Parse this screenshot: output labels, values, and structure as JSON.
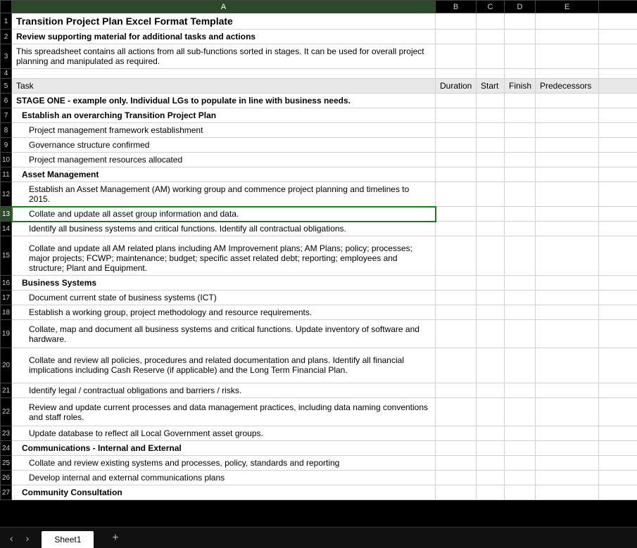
{
  "columns": [
    "A",
    "B",
    "C",
    "D",
    "E"
  ],
  "active_cell": {
    "row": 13,
    "col": "A"
  },
  "rows": [
    {
      "n": 1,
      "type": "title",
      "a": "Transition Project Plan Excel Format Template"
    },
    {
      "n": 2,
      "type": "bold",
      "a": "Review supporting material for additional tasks and actions"
    },
    {
      "n": 3,
      "type": "plain",
      "a": "This spreadsheet contains all actions from all sub-functions sorted in stages. It can be used for overall project planning and manipulated as required."
    },
    {
      "n": 4,
      "type": "empty",
      "a": ""
    },
    {
      "n": 5,
      "type": "header",
      "a": "Task",
      "b": "Duration",
      "c": "Start",
      "d": "Finish",
      "e": "Predecessors"
    },
    {
      "n": 6,
      "type": "bold",
      "a": "STAGE ONE - example only. Individual LGs to populate in line with business needs."
    },
    {
      "n": 7,
      "type": "bold1",
      "a": "Establish an overarching Transition Project Plan"
    },
    {
      "n": 8,
      "type": "p2",
      "a": "Project management framework establishment"
    },
    {
      "n": 9,
      "type": "p2",
      "a": "Governance structure confirmed"
    },
    {
      "n": 10,
      "type": "p2",
      "a": "Project management resources allocated"
    },
    {
      "n": 11,
      "type": "bold1",
      "a": "Asset Management"
    },
    {
      "n": 12,
      "type": "p2",
      "a": "Establish an Asset Management (AM) working group and commence project planning and timelines to 2015."
    },
    {
      "n": 13,
      "type": "p2sel",
      "a": "Collate and update all asset group information and data."
    },
    {
      "n": 14,
      "type": "p2",
      "a": "Identify all business systems and critical functions. Identify all contractual obligations."
    },
    {
      "n": 15,
      "type": "p2tall",
      "a": "Collate and update all AM related plans including AM Improvement plans; AM Plans; policy; processes; major projects; FCWP; maintenance; budget; specific asset related debt; reporting; employees and structure; Plant and Equipment."
    },
    {
      "n": 16,
      "type": "bold1",
      "a": "Business Systems"
    },
    {
      "n": 17,
      "type": "p2",
      "a": "Document current state of business systems (ICT)"
    },
    {
      "n": 18,
      "type": "p2",
      "a": "Establish a working group, project methodology and resource requirements."
    },
    {
      "n": 19,
      "type": "p2t2",
      "a": "Collate, map and document all business systems and critical functions. Update inventory of software and hardware."
    },
    {
      "n": 20,
      "type": "p2tall",
      "a": "Collate and review all policies, procedures and related documentation and plans.  Identify all financial implications including Cash Reserve (if applicable) and the Long Term Financial Plan."
    },
    {
      "n": 21,
      "type": "p2",
      "a": "Identify legal / contractual obligations and barriers / risks."
    },
    {
      "n": 22,
      "type": "p2t2",
      "a": "Review and update current processes and data management practices, including data naming conventions and staff roles."
    },
    {
      "n": 23,
      "type": "p2",
      "a": "Update database to reflect all Local Government asset groups."
    },
    {
      "n": 24,
      "type": "bold1",
      "a": "Communications - Internal and External"
    },
    {
      "n": 25,
      "type": "p2",
      "a": "Collate and review existing systems and processes, policy, standards and reporting"
    },
    {
      "n": 26,
      "type": "p2",
      "a": "Develop internal and external communications plans"
    },
    {
      "n": 27,
      "type": "bold1",
      "a": "Community Consultation"
    }
  ],
  "tabs": {
    "prev_label": "‹",
    "next_label": "›",
    "add_label": "+",
    "items": [
      {
        "label": "Sheet1",
        "active": true
      }
    ]
  }
}
